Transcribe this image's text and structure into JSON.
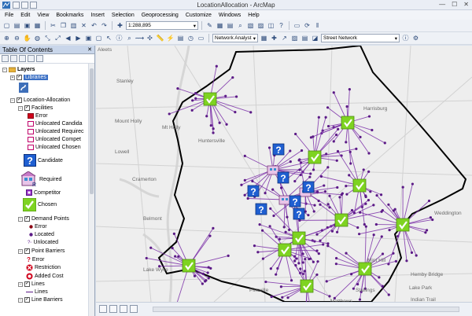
{
  "window": {
    "title": "LocationAllocation - ArcMap",
    "controls": [
      "—",
      "☐",
      "✕"
    ]
  },
  "menu": [
    "File",
    "Edit",
    "View",
    "Bookmarks",
    "Insert",
    "Selection",
    "Geoprocessing",
    "Customize",
    "Windows",
    "Help"
  ],
  "toolbar": {
    "scale_value": "1:288,895",
    "network_analyst_label": "Network Analyst",
    "network_dataset_value": "Street Network"
  },
  "toc": {
    "title": "Table Of Contents",
    "close_glyph": "✕",
    "layers_label": "Layers",
    "libraries_label": "Libraries",
    "group_label": "Location-Allocation",
    "facilities_label": "Facilities",
    "facility_items": [
      "Error",
      "Unlocated Candida",
      "Unlocated Requirec",
      "Unlocated Compet",
      "Unlocated Chosen"
    ],
    "candidate_label": "Candidate",
    "required_label": "Required",
    "competitor_label": "Competitor",
    "chosen_label": "Chosen",
    "demand_label": "Demand Points",
    "demand_items": [
      "Error",
      "Located",
      "Unlocated"
    ],
    "barriers_label": "Point Barriers",
    "barrier_items": [
      "Restriction",
      "Added Cost"
    ],
    "lines_label": "Lines",
    "lines_item": "Lines",
    "line_barriers_label": "Line Barriers"
  },
  "map": {
    "place_labels": [
      "Aleets",
      "Stanley",
      "Mount Holly",
      "Mt Holly",
      "Lowell",
      "Cramerton",
      "Belmont",
      "Huntersville",
      "Harrisburg",
      "Mint Hill",
      "Pineville",
      "Matthews",
      "Lake Wylie",
      "Stallings",
      "Hemby Bridge",
      "Lake Park",
      "Indian Trail",
      "Weddington"
    ],
    "colors": {
      "allocation_lines": "#7b2fa8",
      "demand_points": "#5b1a86",
      "chosen": "#7ed321",
      "candidate": "#1f5fd1",
      "boundary": "#000000",
      "water": "#d6d6d6"
    }
  }
}
